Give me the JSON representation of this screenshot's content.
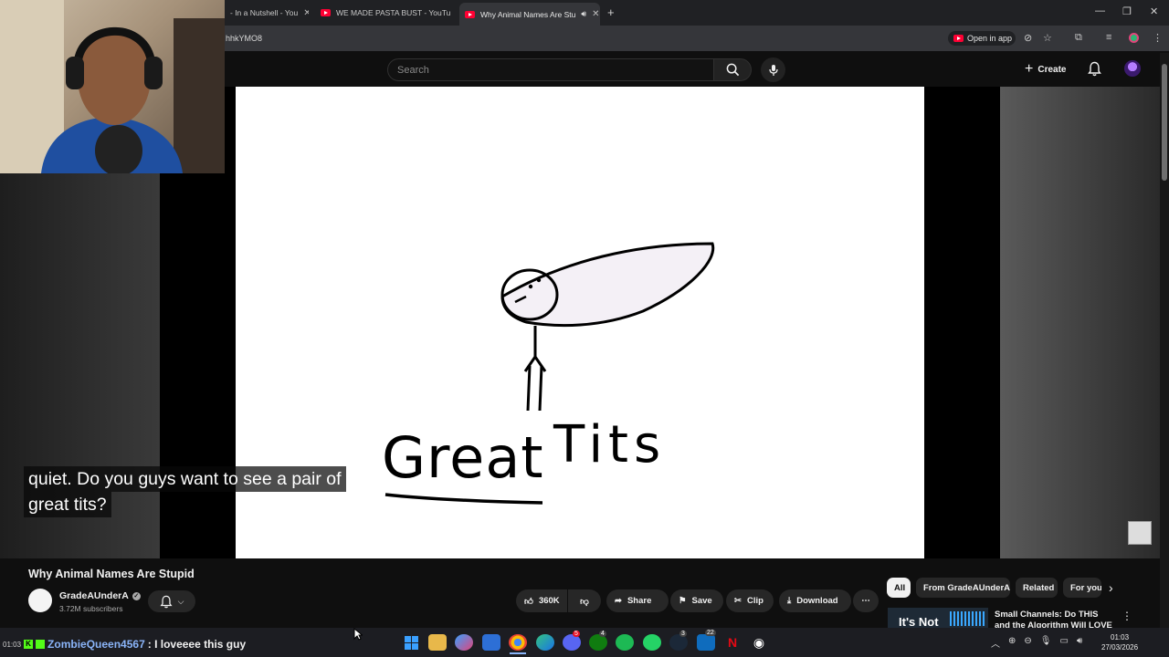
{
  "browser": {
    "tabs": [
      {
        "label": "- In a Nutshell - You"
      },
      {
        "label": "WE MADE PASTA BUST - YouTu"
      },
      {
        "label": "Why Animal Names Are Stu"
      }
    ],
    "new_tab": "+",
    "url": "hhkYMO8",
    "open_in_app": "Open in app"
  },
  "youtube": {
    "search_placeholder": "Search",
    "create_label": "Create"
  },
  "video": {
    "drawing_text_left": "Great",
    "drawing_text_right": "Tits",
    "caption_lines": [
      "quiet. Do you guys want to see a pair of",
      "great tits?"
    ],
    "title": "Why Animal Names Are Stupid",
    "channel_name": "GradeAUnderA",
    "subscribers": "3.72M subscribers",
    "likes": "360K",
    "actions": {
      "share": "Share",
      "save": "Save",
      "clip": "Clip",
      "download": "Download"
    }
  },
  "chips": [
    "All",
    "From GradeAUnderA",
    "Related",
    "For you"
  ],
  "recommendation": {
    "title": "Small Channels: Do THIS and the Algorithm Will LOVE You!",
    "thumb_text": "It's Not"
  },
  "chat": {
    "time": "01:03",
    "user": "ZombieQueen4567",
    "message": ": I loveeee this guy"
  },
  "taskbar": {
    "clock_time": "01:03",
    "clock_date": "27/03/2026",
    "badge_discord": "5",
    "badge_xbox": "4",
    "badge_steam": "3",
    "badge_mail": "22"
  },
  "colors": {
    "youtube_red": "#ff0033",
    "background": "#0f0f0f",
    "chat_username": "#8ab4f8"
  }
}
